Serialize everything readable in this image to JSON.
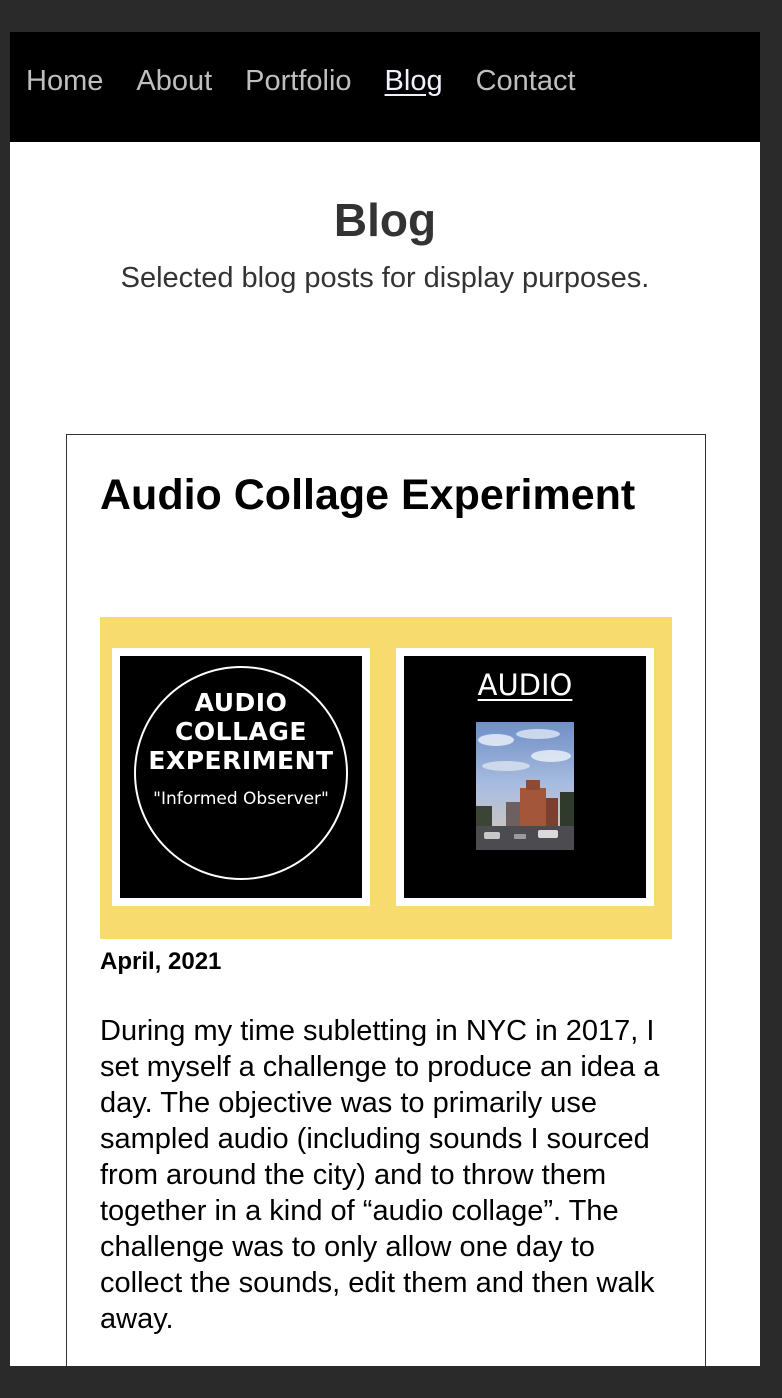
{
  "nav": {
    "items": [
      {
        "label": "Home"
      },
      {
        "label": "About"
      },
      {
        "label": "Portfolio"
      },
      {
        "label": "Blog"
      },
      {
        "label": "Contact"
      }
    ],
    "active": "Blog"
  },
  "header": {
    "title": "Blog",
    "subtitle": "Selected blog posts for display purposes."
  },
  "post": {
    "title": "Audio Collage Experiment",
    "image": {
      "left_tile": {
        "line1": "AUDIO",
        "line2": "COLLAGE",
        "line3": "EXPERIMENT",
        "subtitle": "\"Informed Observer\""
      },
      "right_tile": {
        "title": "AUDIO"
      }
    },
    "date": "April, 2021",
    "body": "During my time subletting in NYC in 2017, I set myself a challenge to produce an idea a day. The objective was to primarily use sampled audio (including sounds I sourced from around the city) and to throw them together in a kind of “audio collage”. The challenge was to only allow one day to collect the sounds, edit them and then walk away."
  },
  "colors": {
    "page_background": "#2a2a2a",
    "nav_background": "#000000",
    "nav_link": "#bfbfbf",
    "image_frame": "#f8db6e"
  }
}
